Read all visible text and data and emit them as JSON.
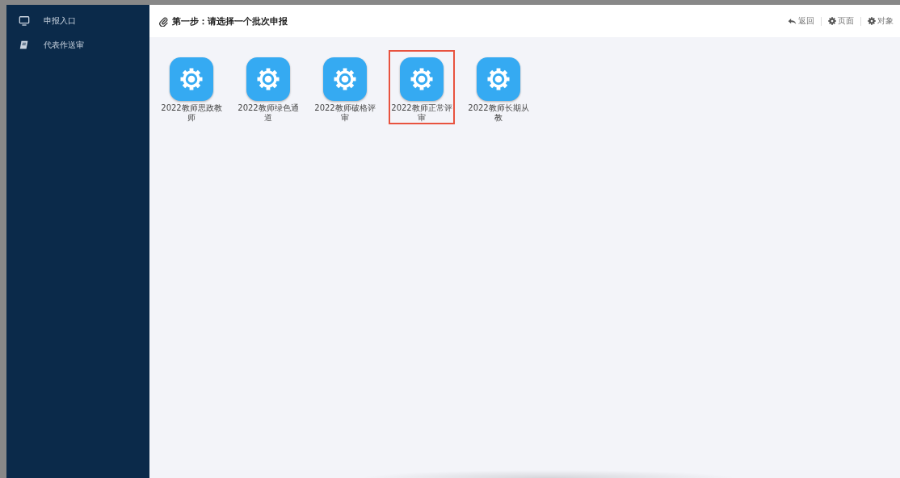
{
  "sidebar": {
    "items": [
      {
        "label": "申报入口",
        "kind": "monitor"
      },
      {
        "label": "代表作送审",
        "kind": "book"
      }
    ]
  },
  "header": {
    "title": "第一步：请选择一个批次申报",
    "actions": [
      {
        "label": "返回",
        "kind": "back"
      },
      {
        "label": "页面",
        "kind": "gear"
      },
      {
        "label": "对象",
        "kind": "gear"
      }
    ]
  },
  "batches": [
    {
      "label": "2022教师思政教师",
      "selected": false
    },
    {
      "label": "2022教师绿色通道",
      "selected": false
    },
    {
      "label": "2022教师破格评审",
      "selected": false
    },
    {
      "label": "2022教师正常评审",
      "selected": true
    },
    {
      "label": "2022教师长期从教",
      "selected": false
    }
  ]
}
